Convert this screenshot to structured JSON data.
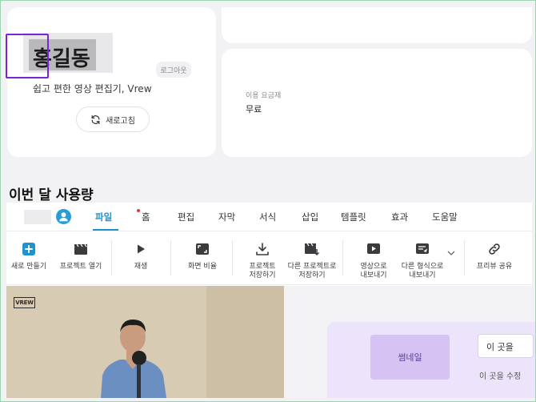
{
  "account": {
    "username": "홍길동",
    "logout_label": "로그아웃",
    "tagline": "쉽고 편한 영상 편집기, Vrew",
    "refresh_label": "새로고침",
    "plan_label": "이용 요금제",
    "plan_value": "무료"
  },
  "usage": {
    "title": "이번 달 사용량"
  },
  "menubar": {
    "items": [
      {
        "label": "파일",
        "active": true
      },
      {
        "label": "홈",
        "active": false
      },
      {
        "label": "편집",
        "active": false
      },
      {
        "label": "자막",
        "active": false
      },
      {
        "label": "서식",
        "active": false
      },
      {
        "label": "삽입",
        "active": false
      },
      {
        "label": "템플릿",
        "active": false
      },
      {
        "label": "효과",
        "active": false
      },
      {
        "label": "도움말",
        "active": false
      }
    ]
  },
  "toolbar": {
    "items": [
      {
        "label": "새로 만들기",
        "icon": "plus-square-icon"
      },
      {
        "label": "프로젝트 열기",
        "icon": "clapperboard-icon"
      },
      {
        "label": "재생",
        "icon": "play-icon"
      },
      {
        "label": "화면 비율",
        "icon": "aspect-ratio-icon"
      },
      {
        "label": "프로젝트\n저장하기",
        "icon": "download-icon"
      },
      {
        "label": "다른 프로젝트로\n저장하기",
        "icon": "clapperboard-save-icon"
      },
      {
        "label": "영상으로\n내보내기",
        "icon": "video-export-icon"
      },
      {
        "label": "다른 형식으로\n내보내기",
        "icon": "document-export-icon"
      },
      {
        "label": "프리뷰 공유",
        "icon": "link-icon"
      }
    ]
  },
  "preview": {
    "logo_text": "VREW"
  },
  "thumbnail": {
    "button_label": "썸네일",
    "edit_box_text": "이 곳을",
    "edit_hint": "이 곳을 수정"
  },
  "colors": {
    "accent": "#1f93cf",
    "highlight": "#7a24d6",
    "thumbnail_bg": "#d6c3f3"
  }
}
